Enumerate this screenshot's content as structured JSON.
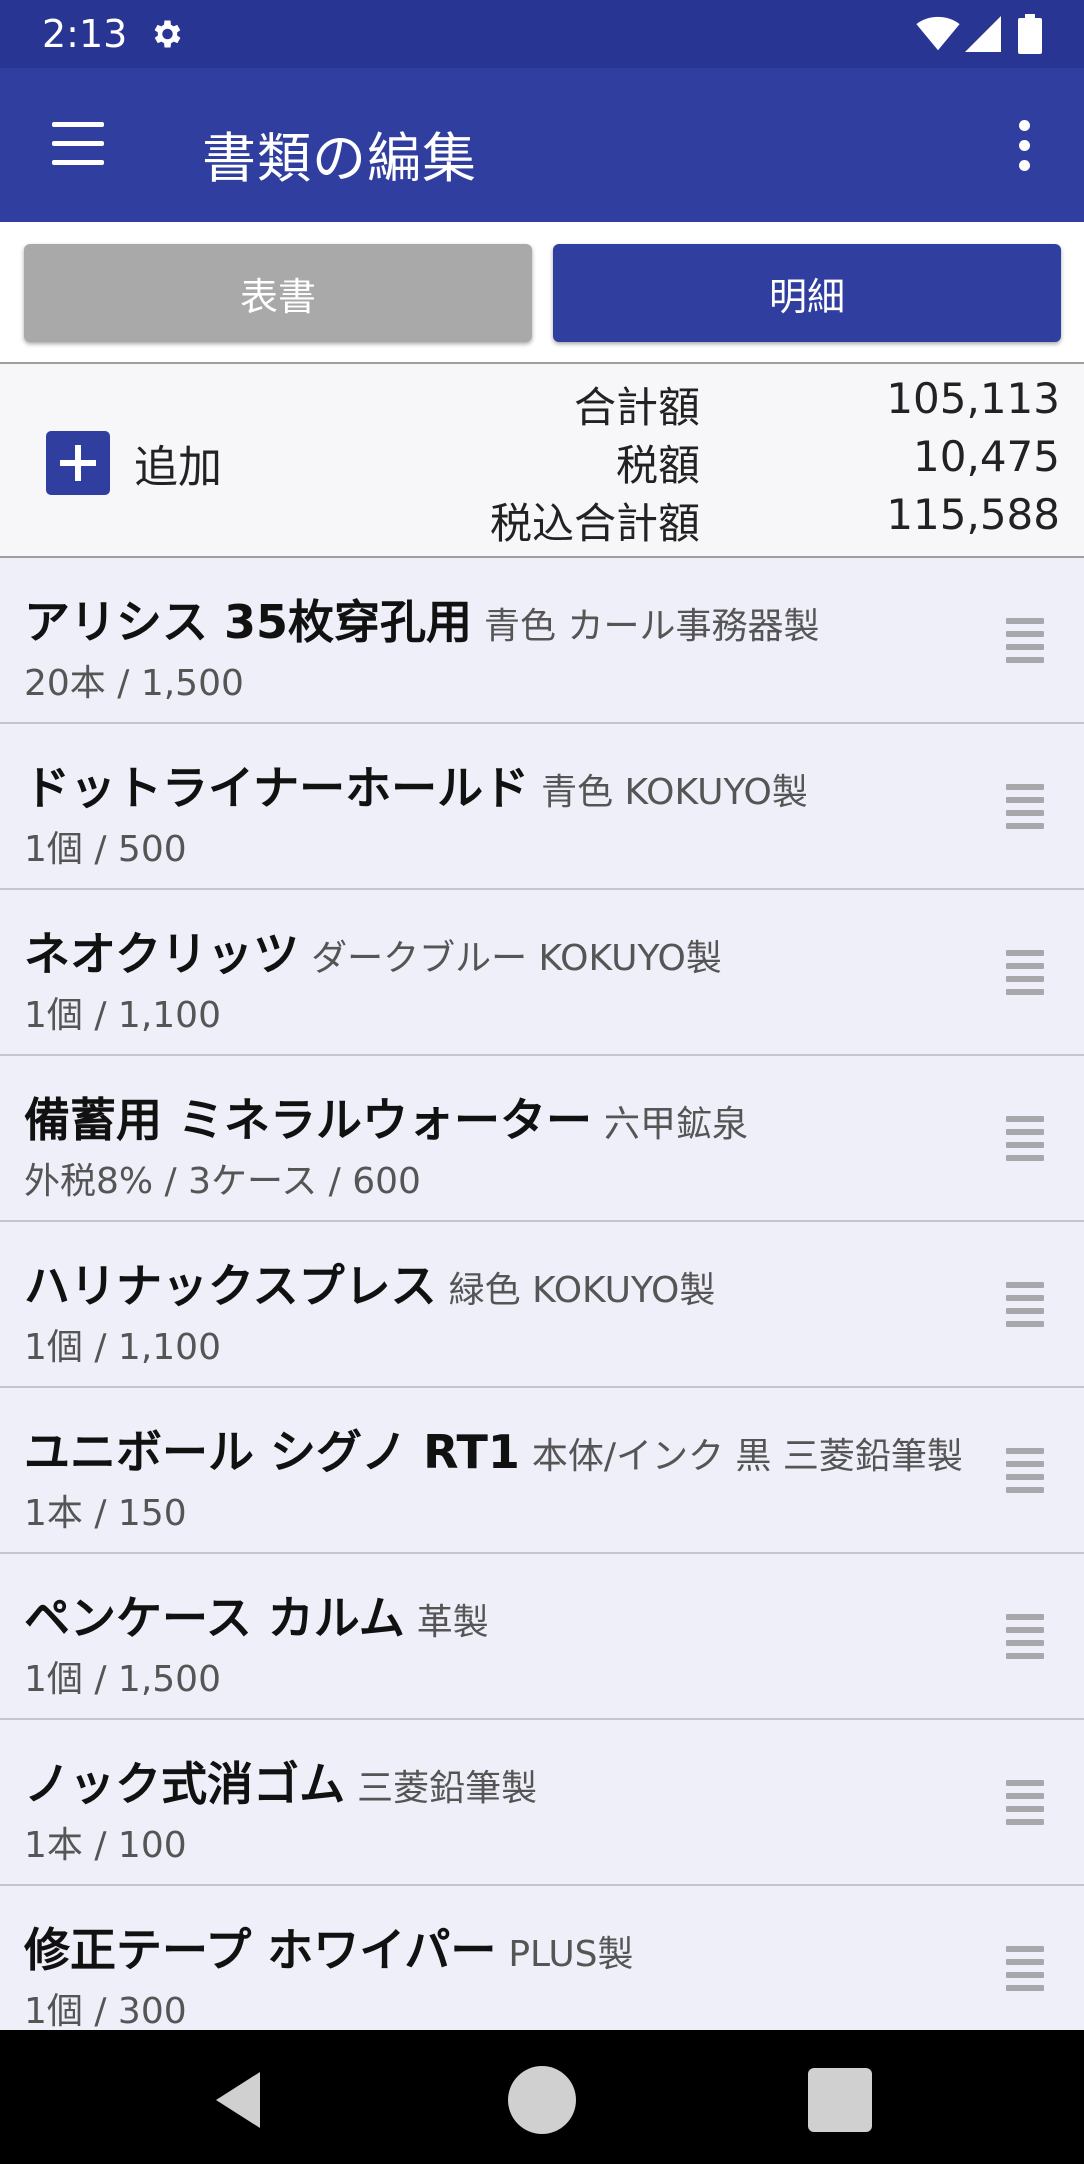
{
  "status_bar": {
    "time": "2:13",
    "icons": [
      "settings-icon",
      "wifi-icon",
      "signal-icon",
      "battery-icon"
    ]
  },
  "app_bar": {
    "title": "書類の編集",
    "menu_icon": "hamburger-menu-icon",
    "overflow_icon": "more-vert-icon",
    "color": "#303f9f"
  },
  "tabs": [
    {
      "label": "表書",
      "selected": false
    },
    {
      "label": "明細",
      "selected": true
    }
  ],
  "summary": {
    "add_label": "追加",
    "rows": [
      {
        "label": "合計額",
        "value": "105,113"
      },
      {
        "label": "税額",
        "value": "10,475"
      },
      {
        "label": "税込合計額",
        "value": "115,588"
      }
    ]
  },
  "items": [
    {
      "name": "アリシス 35枚穿孔用",
      "detail": "青色 カール事務器製",
      "sub": "20本 / 1,500"
    },
    {
      "name": "ドットライナーホールド",
      "detail": "青色 KOKUYO製",
      "sub": "1個 / 500"
    },
    {
      "name": "ネオクリッツ",
      "detail": "ダークブルー KOKUYO製",
      "sub": "1個 / 1,100"
    },
    {
      "name": "備蓄用 ミネラルウォーター",
      "detail": "六甲鉱泉",
      "sub": "外税8% / 3ケース / 600"
    },
    {
      "name": "ハリナックスプレス",
      "detail": "緑色 KOKUYO製",
      "sub": "1個 / 1,100"
    },
    {
      "name": "ユニボール シグノ RT1",
      "detail": "本体/インク 黒 三菱鉛筆製",
      "sub": "1本 / 150"
    },
    {
      "name": "ペンケース カルム",
      "detail": "革製",
      "sub": "1個 / 1,500"
    },
    {
      "name": "ノック式消ゴム",
      "detail": "三菱鉛筆製",
      "sub": "1本 / 100"
    },
    {
      "name": "修正テープ ホワイパー",
      "detail": "PLUS製",
      "sub": "1個 / 300"
    }
  ],
  "nav_bar": {
    "buttons": [
      "back-icon",
      "home-icon",
      "recents-icon"
    ]
  }
}
